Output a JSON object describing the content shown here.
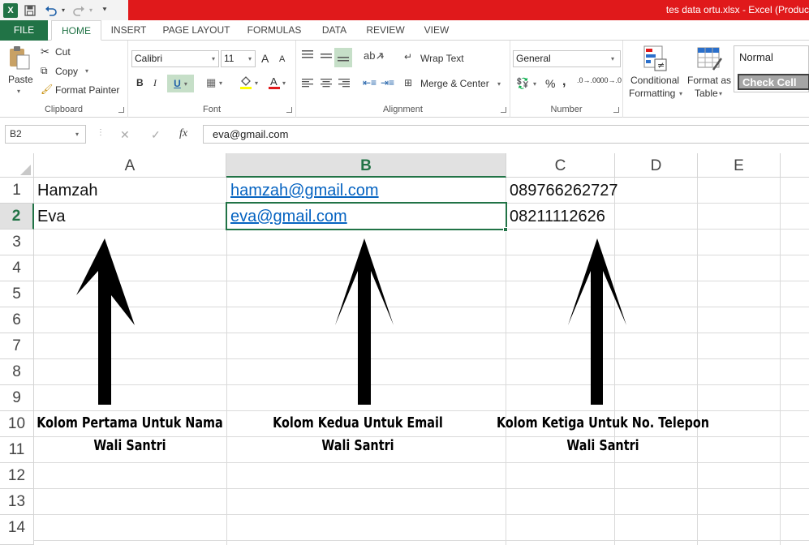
{
  "window": {
    "title": "tes data ortu.xlsx - Excel (Produc",
    "app_icon": "X"
  },
  "tabs": [
    {
      "label": "FILE"
    },
    {
      "label": "HOME"
    },
    {
      "label": "INSERT"
    },
    {
      "label": "PAGE LAYOUT"
    },
    {
      "label": "FORMULAS"
    },
    {
      "label": "DATA"
    },
    {
      "label": "REVIEW"
    },
    {
      "label": "VIEW"
    }
  ],
  "ribbon": {
    "clipboard": {
      "group_label": "Clipboard",
      "paste": "Paste",
      "cut": "Cut",
      "copy": "Copy",
      "format_painter": "Format Painter"
    },
    "font": {
      "group_label": "Font",
      "font_name": "Calibri",
      "font_size": "11",
      "bold": "B",
      "italic": "I",
      "underline": "U",
      "grow": "A",
      "shrink": "A"
    },
    "alignment": {
      "group_label": "Alignment",
      "wrap_text": "Wrap Text",
      "merge_center": "Merge & Center"
    },
    "number": {
      "group_label": "Number",
      "format": "General",
      "percent": "%",
      "comma": ",",
      "inc_decimal": ".0→.00",
      "dec_decimal": ".00→.0"
    },
    "styles": {
      "conditional_formatting_1": "Conditional",
      "conditional_formatting_2": "Formatting",
      "format_as_table_1": "Format as",
      "format_as_table_2": "Table",
      "normal": "Normal",
      "check_cell": "Check Cell"
    }
  },
  "formula_bar": {
    "name_box": "B2",
    "cancel": "✕",
    "enter": "✓",
    "fx": "fx",
    "value": "eva@gmail.com"
  },
  "columns": [
    "A",
    "B",
    "C",
    "D",
    "E"
  ],
  "rows": [
    "1",
    "2",
    "3",
    "4",
    "5",
    "6",
    "7",
    "8",
    "9",
    "10",
    "11",
    "12",
    "13",
    "14"
  ],
  "selected_cell": "B2",
  "cells": {
    "A1": "Hamzah",
    "B1": "hamzah@gmail.com",
    "C1": "089766262727",
    "A2": "Eva",
    "B2": "eva@gmail.com",
    "C2": "08211112626"
  },
  "annotations": {
    "col_a_line1": "Kolom Pertama Untuk Nama",
    "col_a_line2": "Wali Santri",
    "col_b_line1": "Kolom Kedua Untuk Email",
    "col_b_line2": "Wali Santri",
    "col_c_line1": "Kolom Ketiga Untuk No. Telepon",
    "col_c_line2": "Wali Santri"
  },
  "colors": {
    "title_bar": "#e0191b",
    "excel_green": "#217346",
    "hyperlink": "#0563c1"
  }
}
